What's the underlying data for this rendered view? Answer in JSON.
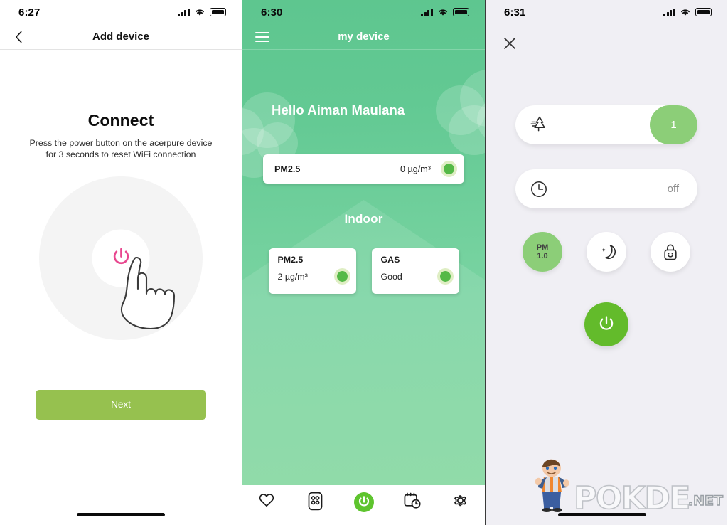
{
  "screen1": {
    "status": {
      "time": "6:27",
      "signal_icon": "cellular-bars-icon",
      "wifi_icon": "wifi-icon",
      "battery_icon": "battery-icon"
    },
    "nav": {
      "back_icon": "back-chevron-icon",
      "title": "Add device"
    },
    "heading": "Connect",
    "body": "Press the power button on the acerpure device for 3 seconds to reset WiFi connection",
    "power_icon": "power-icon",
    "hand_icon": "pointing-hand-icon",
    "next_label": "Next"
  },
  "screen2": {
    "status": {
      "time": "6:30",
      "signal_icon": "cellular-bars-icon",
      "wifi_icon": "wifi-icon",
      "battery_icon": "battery-icon"
    },
    "nav": {
      "menu_icon": "hamburger-menu-icon",
      "title": "my device"
    },
    "greeting": "Hello Aiman Maulana",
    "outdoor_card": {
      "label": "PM2.5",
      "value": "0 µg/m³",
      "status_icon": "green-status-dot"
    },
    "section_title": "Indoor",
    "indoor_cards": [
      {
        "label": "PM2.5",
        "value": "2 µg/m³",
        "status_icon": "green-status-dot"
      },
      {
        "label": "GAS",
        "value": "Good",
        "status_icon": "green-status-dot"
      }
    ],
    "tabs": [
      {
        "name": "favorites",
        "icon": "heart-icon",
        "active": false
      },
      {
        "name": "remote",
        "icon": "remote-control-icon",
        "active": false
      },
      {
        "name": "power",
        "icon": "power-icon",
        "active": true
      },
      {
        "name": "schedule",
        "icon": "calendar-clock-icon",
        "active": false
      },
      {
        "name": "settings",
        "icon": "gear-icon",
        "active": false
      }
    ]
  },
  "screen3": {
    "status": {
      "time": "6:31",
      "signal_icon": "cellular-bars-icon",
      "wifi_icon": "wifi-icon",
      "battery_icon": "battery-icon"
    },
    "close_icon": "close-x-icon",
    "fan_speed": {
      "icon": "pine-tree-wind-icon",
      "value": "1"
    },
    "timer": {
      "icon": "clock-icon",
      "value": "off"
    },
    "modes": [
      {
        "name": "pm1-mode",
        "label": "PM\n1.0",
        "label_line1": "PM",
        "label_line2": "1.0",
        "icon": "pm-text",
        "active": true
      },
      {
        "name": "night-mode",
        "icon": "moon-star-icon",
        "active": false
      },
      {
        "name": "child-lock-mode",
        "icon": "lock-smile-icon",
        "active": false
      }
    ],
    "power_button": {
      "icon": "power-icon"
    }
  },
  "watermark": {
    "brand": "POKDE",
    "suffix": ".NET",
    "mascot_icon": "pokde-mascot-icon"
  },
  "colors": {
    "accent_green": "#63bb2b",
    "button_green": "#96c14f",
    "pill_green": "#8cce78",
    "hero_green_top": "#5ec68f",
    "hero_green_bottom": "#84d79f",
    "power_pink": "#e8478f",
    "panel3_bg": "#f0eff4"
  }
}
